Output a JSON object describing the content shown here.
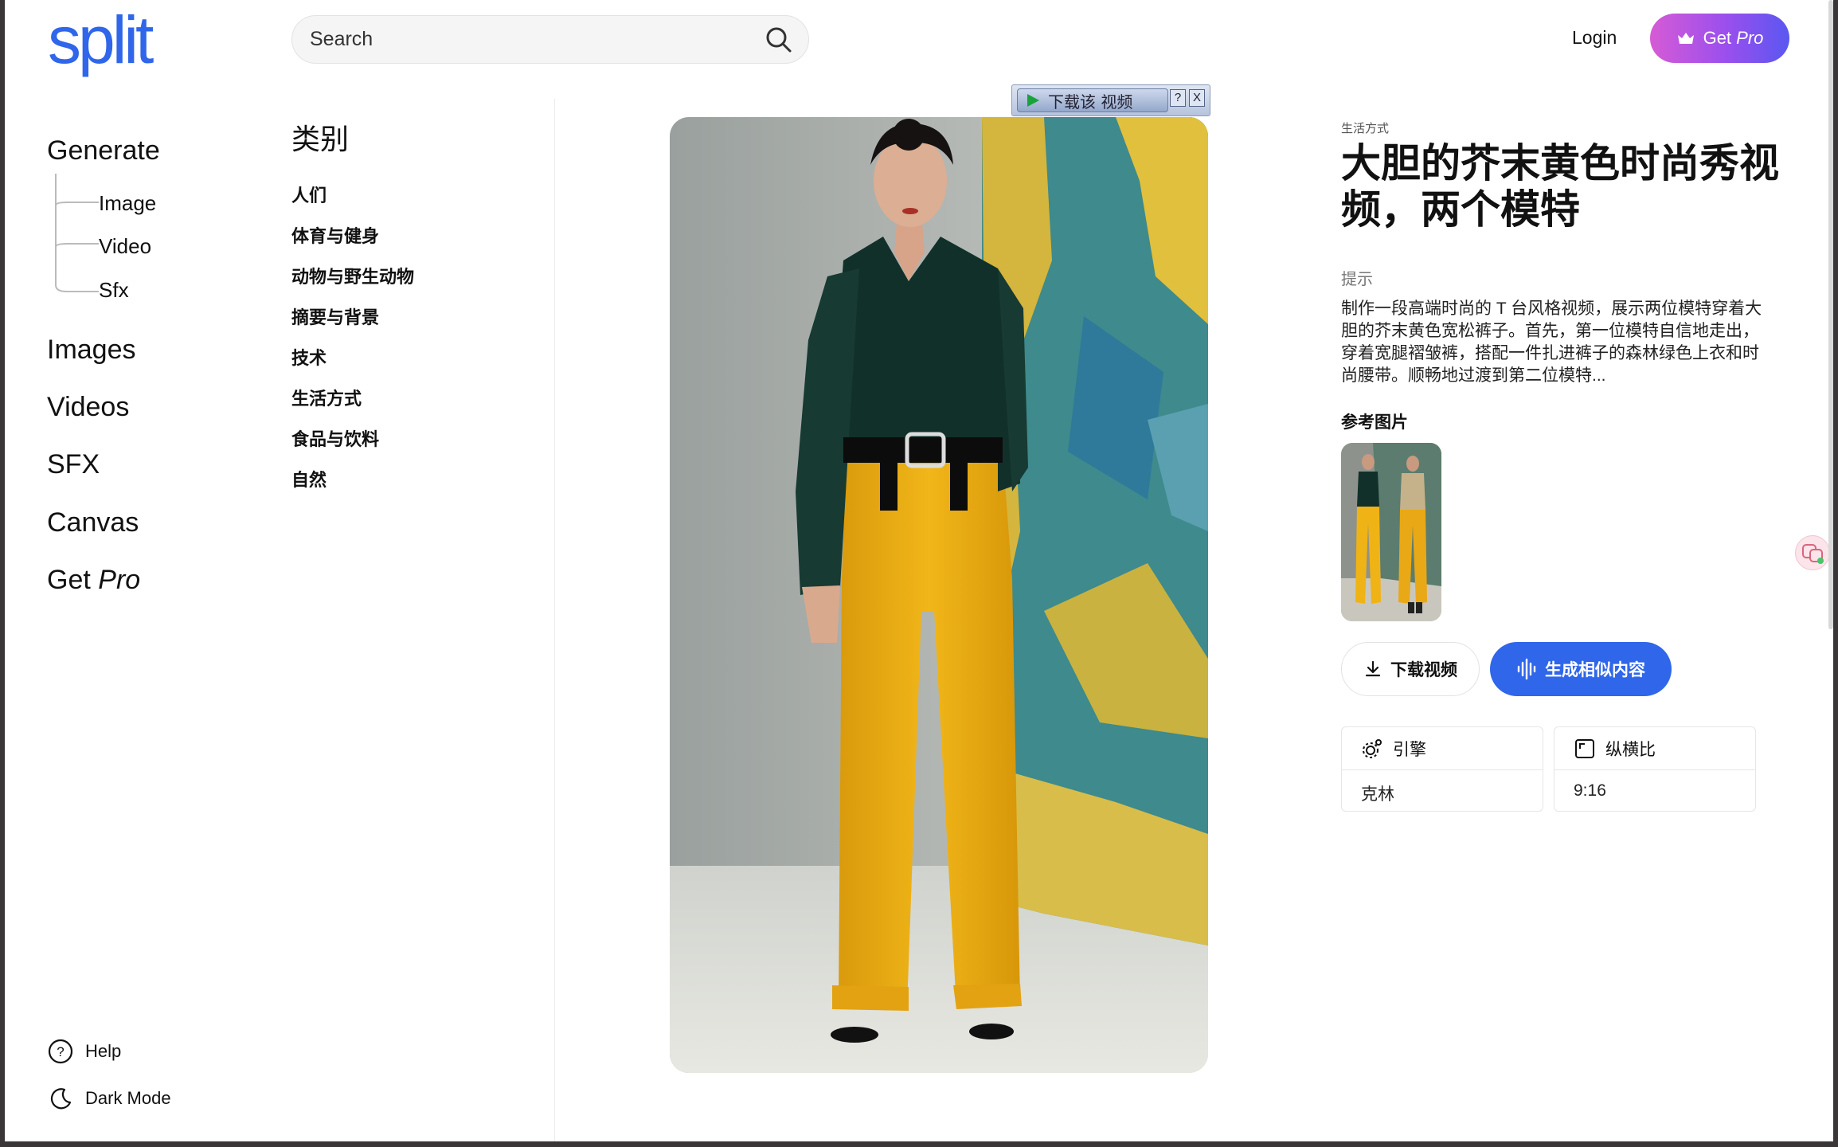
{
  "brand": {
    "logo": "split"
  },
  "search": {
    "placeholder": "Search"
  },
  "header": {
    "login": "Login",
    "get_pro_prefix": "Get",
    "get_pro_suffix": "Pro"
  },
  "sidebar": {
    "generate": "Generate",
    "generate_children": [
      "Image",
      "Video",
      "Sfx"
    ],
    "items": [
      "Images",
      "Videos",
      "SFX",
      "Canvas"
    ],
    "get_pro_prefix": "Get",
    "get_pro_suffix": "Pro",
    "help": "Help",
    "dark_mode": "Dark Mode"
  },
  "categories": {
    "title": "类别",
    "items": [
      "人们",
      "体育与健身",
      "动物与野生动物",
      "摘要与背景",
      "技术",
      "生活方式",
      "食品与饮料",
      "自然"
    ]
  },
  "download_overlay": {
    "label": "下载该 视频",
    "help": "?",
    "close": "X"
  },
  "detail": {
    "kicker": "生活方式",
    "title": "大胆的芥末黄色时尚秀视频，两个模特",
    "prompt_label": "提示",
    "prompt": "制作一段高端时尚的 T 台风格视频，展示两位模特穿着大胆的芥末黄色宽松裤子。首先，第一位模特自信地走出，穿着宽腿褶皱裤，搭配一件扎进裤子的森林绿色上衣和时尚腰带。顺畅地过渡到第二位模特...",
    "reference_label": "参考图片",
    "download_button": "下载视频",
    "generate_button": "生成相似内容",
    "engine_label": "引擎",
    "engine_value": "克林",
    "aspect_label": "纵横比",
    "aspect_value": "9:16"
  },
  "colors": {
    "accent": "#2f66ea",
    "pro_gradient_start": "#d65bd5",
    "pro_gradient_end": "#5a57f0"
  },
  "icons": [
    "search-icon",
    "crown-icon",
    "help-icon",
    "moon-icon",
    "download-icon",
    "waveform-icon",
    "engine-icon",
    "aspect-ratio-icon",
    "play-icon",
    "translate-icon"
  ]
}
